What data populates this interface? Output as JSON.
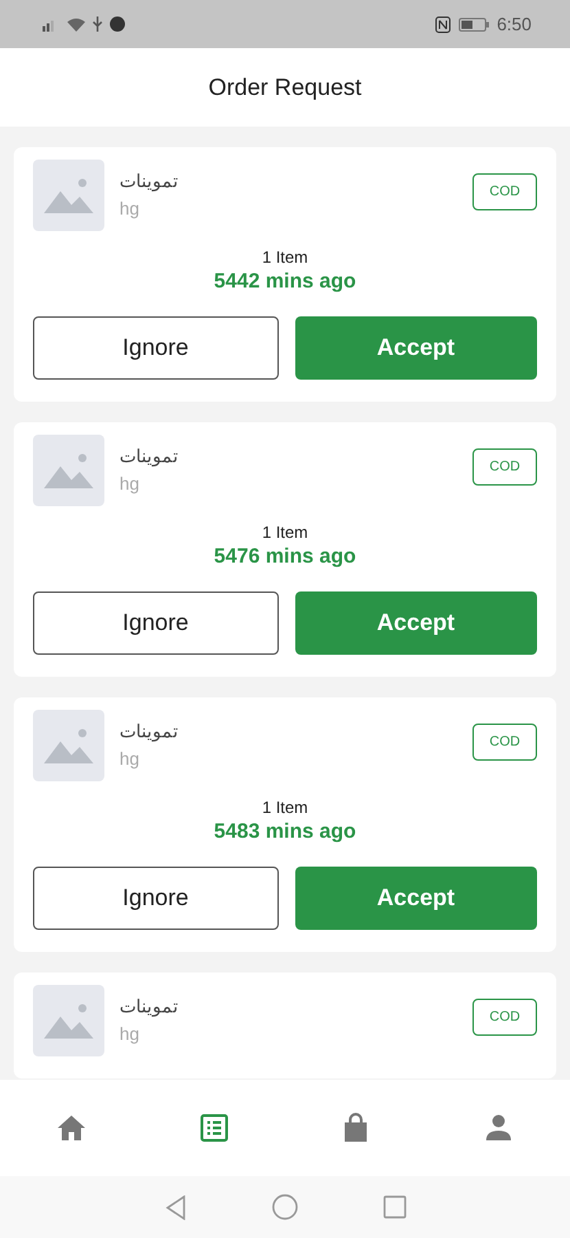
{
  "status_bar": {
    "time": "6:50"
  },
  "header": {
    "title": "Order Request"
  },
  "orders": [
    {
      "name": "تموينات",
      "subtitle": "hg",
      "payment": "COD",
      "items": "1 Item",
      "time_ago": "5442 mins ago",
      "buttons": [
        "Ignore",
        "Accept"
      ]
    },
    {
      "name": "تموينات",
      "subtitle": "hg",
      "payment": "COD",
      "items": "1 Item",
      "time_ago": "5476 mins ago",
      "buttons": [
        "Ignore",
        "Accept"
      ]
    },
    {
      "name": "تموينات",
      "subtitle": "hg",
      "payment": "COD",
      "items": "1 Item",
      "time_ago": "5483 mins ago",
      "buttons": [
        "Ignore",
        "Accept"
      ]
    },
    {
      "name": "تموينات",
      "subtitle": "hg",
      "payment": "COD"
    }
  ],
  "bottom_nav": [
    {
      "kind": "home",
      "selected": false
    },
    {
      "kind": "orders",
      "selected": true
    },
    {
      "kind": "bag",
      "selected": false
    },
    {
      "kind": "profile",
      "selected": false
    }
  ]
}
